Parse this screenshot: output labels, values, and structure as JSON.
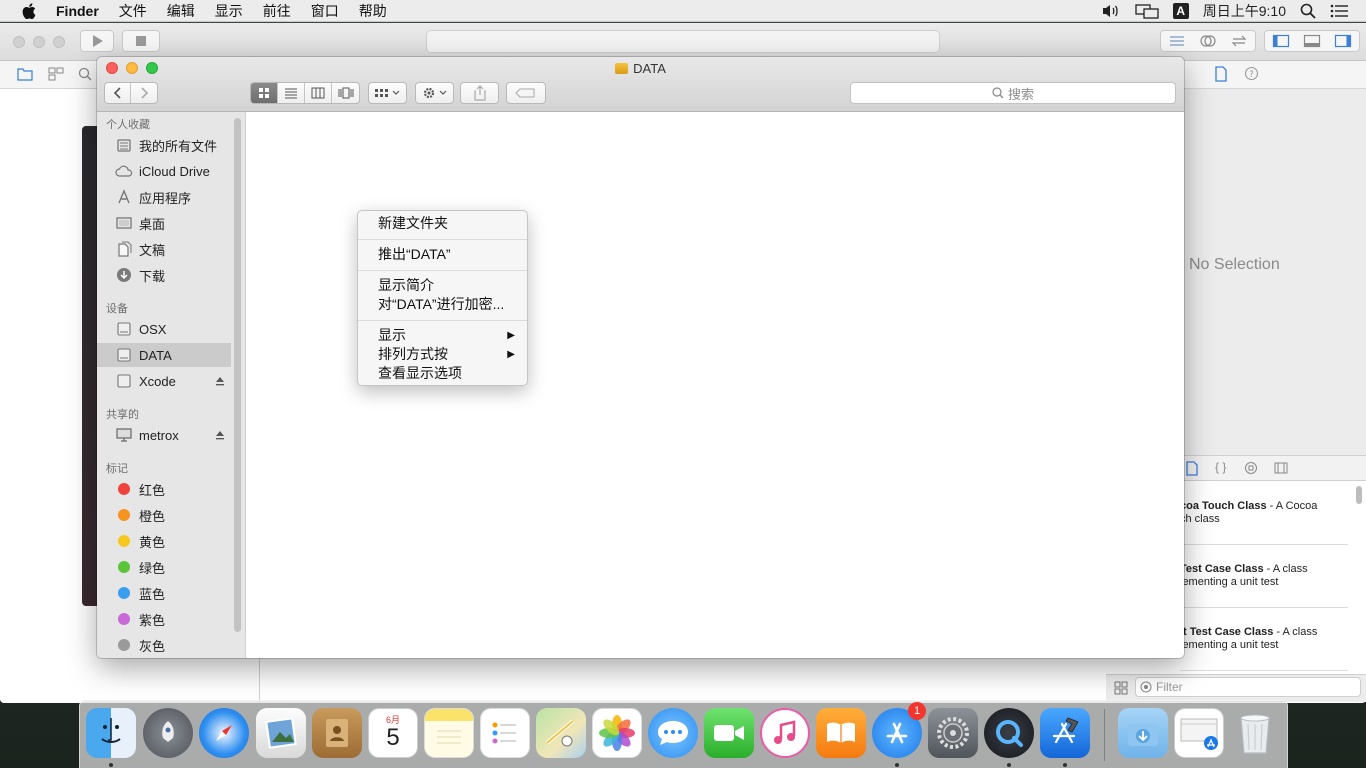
{
  "menubar": {
    "app_name": "Finder",
    "items": [
      "文件",
      "编辑",
      "显示",
      "前往",
      "窗口",
      "帮助"
    ],
    "input_method": "A",
    "clock": "周日上午9:10",
    "icons": [
      "volume-icon",
      "display-icon",
      "input-method-icon",
      "spotlight-icon",
      "notification-center-icon"
    ]
  },
  "xcode": {
    "inspector_placeholder": "No Selection",
    "library_items": [
      {
        "title": "coa Touch Class",
        "desc_1": " - A Cocoa",
        "desc_2": "ch class"
      },
      {
        "title": "Test Case Class",
        "desc_1": " - A class",
        "desc_2": "lementing a unit test"
      },
      {
        "title": "it Test Case Class",
        "desc_1": " - A class",
        "desc_2": "lementing a unit test"
      }
    ],
    "filter_placeholder": "Filter"
  },
  "finder": {
    "title": "DATA",
    "search_placeholder": "搜索",
    "view_modes": [
      "icon-view",
      "list-view",
      "column-view",
      "cover-flow-view"
    ],
    "active_view": "icon-view",
    "sidebar": {
      "favorites_header": "个人收藏",
      "favorites": [
        {
          "label": "我的所有文件",
          "icon": "all-files-icon"
        },
        {
          "label": "iCloud Drive",
          "icon": "icloud-icon"
        },
        {
          "label": "应用程序",
          "icon": "applications-icon"
        },
        {
          "label": "桌面",
          "icon": "desktop-icon"
        },
        {
          "label": "文稿",
          "icon": "documents-icon"
        },
        {
          "label": "下载",
          "icon": "downloads-icon"
        }
      ],
      "devices_header": "设备",
      "devices": [
        {
          "label": "OSX",
          "icon": "disk-icon",
          "eject": false,
          "selected": false
        },
        {
          "label": "DATA",
          "icon": "disk-icon",
          "eject": false,
          "selected": true
        },
        {
          "label": "Xcode",
          "icon": "disk-icon",
          "eject": true,
          "selected": false
        }
      ],
      "shared_header": "共享的",
      "shared": [
        {
          "label": "metrox",
          "icon": "computer-icon",
          "eject": true
        }
      ],
      "tags_header": "标记",
      "tags": [
        {
          "label": "红色",
          "color": "#f0423c"
        },
        {
          "label": "橙色",
          "color": "#f6921e"
        },
        {
          "label": "黄色",
          "color": "#f6c81e"
        },
        {
          "label": "绿色",
          "color": "#5ac337"
        },
        {
          "label": "蓝色",
          "color": "#3a9ef0"
        },
        {
          "label": "紫色",
          "color": "#c969d8"
        },
        {
          "label": "灰色",
          "color": "#9a9a9a"
        }
      ]
    }
  },
  "context_menu": {
    "new_folder": "新建文件夹",
    "eject": "推出“DATA”",
    "get_info": "显示简介",
    "encrypt": "对“DATA”进行加密...",
    "view": "显示",
    "sort_by": "排列方式按",
    "view_options": "查看显示选项",
    "submenu_arrow": "▶"
  },
  "dock": {
    "apps": [
      {
        "name": "Finder",
        "running": true
      },
      {
        "name": "Launchpad",
        "running": false
      },
      {
        "name": "Safari",
        "running": false
      },
      {
        "name": "Preview",
        "running": false
      },
      {
        "name": "Contacts",
        "running": false
      },
      {
        "name": "Calendar",
        "running": false,
        "month": "6月",
        "day": "5"
      },
      {
        "name": "Notes",
        "running": false
      },
      {
        "name": "Reminders",
        "running": false
      },
      {
        "name": "Maps",
        "running": false
      },
      {
        "name": "Photos",
        "running": false
      },
      {
        "name": "Messages",
        "running": false
      },
      {
        "name": "FaceTime",
        "running": false
      },
      {
        "name": "iTunes",
        "running": false
      },
      {
        "name": "iBooks",
        "running": false
      },
      {
        "name": "App Store",
        "running": true,
        "badge": "1"
      },
      {
        "name": "System Preferences",
        "running": false
      },
      {
        "name": "QuickTime Player",
        "running": true
      },
      {
        "name": "Xcode",
        "running": true
      }
    ],
    "stacks": [
      "Downloads",
      "App Store document"
    ],
    "trash": "Trash"
  }
}
